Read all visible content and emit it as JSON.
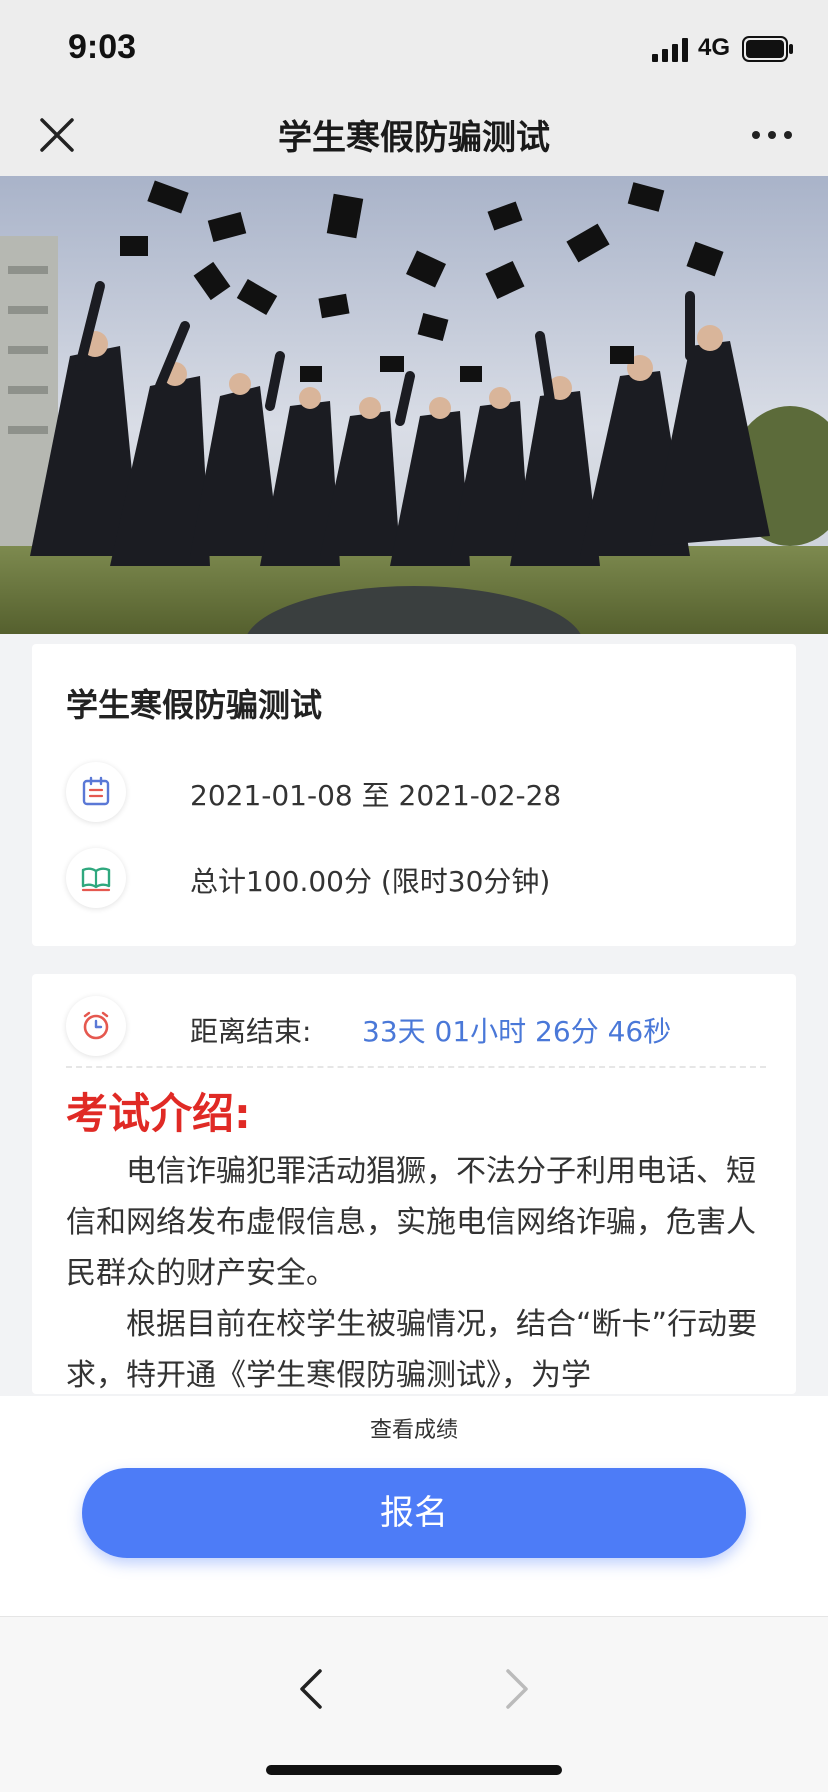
{
  "status_bar": {
    "time": "9:03",
    "network": "4G",
    "icons": [
      "signal-icon",
      "battery-icon"
    ]
  },
  "nav": {
    "title": "学生寒假防骗测试",
    "close_icon": "close-icon",
    "more_icon": "more-icon"
  },
  "hero": {
    "icon": "graduation-photo"
  },
  "info_card": {
    "title": "学生寒假防骗测试",
    "date_range": "2021-01-08 至 2021-02-28",
    "score_info": "总计100.00分 (限时30分钟)",
    "date_icon": "calendar-icon",
    "score_icon": "book-icon"
  },
  "countdown": {
    "label": "距离结束:",
    "value": "33天 01小时 26分 46秒",
    "icon": "clock-icon",
    "value_color": "#4a78d8"
  },
  "intro": {
    "heading": "考试介绍:",
    "heading_color": "#e02a25",
    "paragraphs": [
      "电信诈骗犯罪活动猖獗，不法分子利用电话、短信和网络发布虚假信息，实施电信网络诈骗，危害人民群众的财产安全。",
      "根据目前在校学生被骗情况，结合“断卡”行动要求，特开通《学生寒假防骗测试》，为学"
    ]
  },
  "actions": {
    "view_scores": "查看成绩",
    "register": "报名",
    "register_color": "#4d7cf7"
  },
  "browser": {
    "back_icon": "chevron-left-icon",
    "forward_icon": "chevron-right-icon"
  }
}
